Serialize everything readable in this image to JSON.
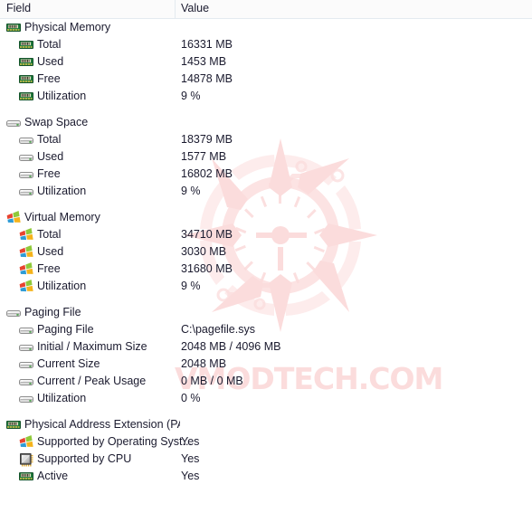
{
  "header": {
    "field_label": "Field",
    "value_label": "Value"
  },
  "watermark": {
    "text": "VMODTECH.COM",
    "color": "#fbdcdc",
    "emblem": "circular-tech-gear-emblem"
  },
  "colors": {
    "text": "#1a1a2e",
    "header_bg": "#fbfbfb",
    "header_border": "#e4eaf0",
    "page_bg": "#ffffff",
    "memory_icon_green": "#1f7a3d",
    "memory_icon_gold": "#e8c84a",
    "drive_icon_gray": "#c8c8c8",
    "cpu_icon_gold": "#e0a92c"
  },
  "rows": [
    {
      "level": 0,
      "icon": "memory-stick-icon",
      "label": "Physical Memory",
      "value": "",
      "group_start": false
    },
    {
      "level": 1,
      "icon": "memory-stick-icon",
      "label": "Total",
      "value": "16331 MB",
      "group_start": false
    },
    {
      "level": 1,
      "icon": "memory-stick-icon",
      "label": "Used",
      "value": "1453 MB",
      "group_start": false
    },
    {
      "level": 1,
      "icon": "memory-stick-icon",
      "label": "Free",
      "value": "14878 MB",
      "group_start": false
    },
    {
      "level": 1,
      "icon": "memory-stick-icon",
      "label": "Utilization",
      "value": "9 %",
      "group_start": false
    },
    {
      "level": 0,
      "icon": "drive-icon",
      "label": "Swap Space",
      "value": "",
      "group_start": true
    },
    {
      "level": 1,
      "icon": "drive-icon",
      "label": "Total",
      "value": "18379 MB",
      "group_start": false
    },
    {
      "level": 1,
      "icon": "drive-icon",
      "label": "Used",
      "value": "1577 MB",
      "group_start": false
    },
    {
      "level": 1,
      "icon": "drive-icon",
      "label": "Free",
      "value": "16802 MB",
      "group_start": false
    },
    {
      "level": 1,
      "icon": "drive-icon",
      "label": "Utilization",
      "value": "9 %",
      "group_start": false
    },
    {
      "level": 0,
      "icon": "windows-logo-icon",
      "label": "Virtual Memory",
      "value": "",
      "group_start": true
    },
    {
      "level": 1,
      "icon": "windows-logo-icon",
      "label": "Total",
      "value": "34710 MB",
      "group_start": false
    },
    {
      "level": 1,
      "icon": "windows-logo-icon",
      "label": "Used",
      "value": "3030 MB",
      "group_start": false
    },
    {
      "level": 1,
      "icon": "windows-logo-icon",
      "label": "Free",
      "value": "31680 MB",
      "group_start": false
    },
    {
      "level": 1,
      "icon": "windows-logo-icon",
      "label": "Utilization",
      "value": "9 %",
      "group_start": false
    },
    {
      "level": 0,
      "icon": "drive-icon",
      "label": "Paging File",
      "value": "",
      "group_start": true
    },
    {
      "level": 1,
      "icon": "drive-icon",
      "label": "Paging File",
      "value": "C:\\pagefile.sys",
      "group_start": false
    },
    {
      "level": 1,
      "icon": "drive-icon",
      "label": "Initial / Maximum Size",
      "value": "2048 MB / 4096 MB",
      "group_start": false
    },
    {
      "level": 1,
      "icon": "drive-icon",
      "label": "Current Size",
      "value": "2048 MB",
      "group_start": false
    },
    {
      "level": 1,
      "icon": "drive-icon",
      "label": "Current / Peak Usage",
      "value": "0 MB / 0 MB",
      "group_start": false
    },
    {
      "level": 1,
      "icon": "drive-icon",
      "label": "Utilization",
      "value": "0 %",
      "group_start": false
    },
    {
      "level": 0,
      "icon": "memory-stick-icon",
      "label": "Physical Address Extension (PAE)",
      "value": "",
      "group_start": true
    },
    {
      "level": 1,
      "icon": "windows-logo-icon",
      "label": "Supported by Operating Syst...",
      "value": "Yes",
      "group_start": false
    },
    {
      "level": 1,
      "icon": "cpu-chip-icon",
      "label": "Supported by CPU",
      "value": "Yes",
      "group_start": false
    },
    {
      "level": 1,
      "icon": "memory-stick-icon",
      "label": "Active",
      "value": "Yes",
      "group_start": false
    }
  ]
}
